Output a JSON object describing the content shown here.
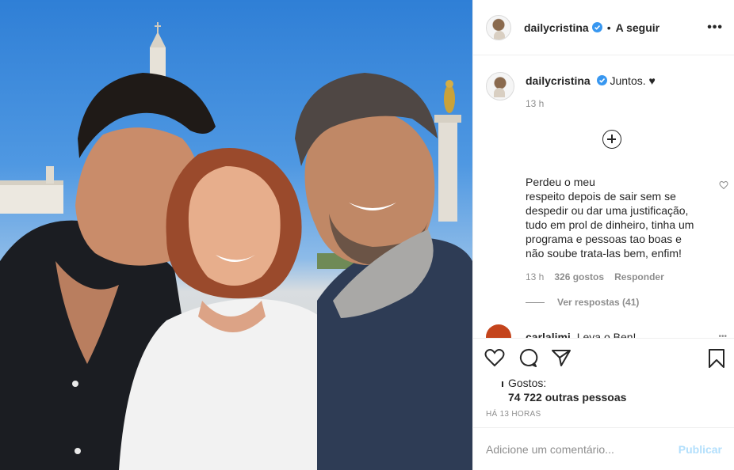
{
  "post": {
    "image_alt": "Selfie of three people in front of a sanctuary"
  },
  "header": {
    "username": "dailycristina",
    "separator": "•",
    "follow_label": "A seguir",
    "more_label": "•••"
  },
  "caption": {
    "username": "dailycristina",
    "text": "Juntos. ♥",
    "time": "13 h"
  },
  "comment": {
    "text": "Perdeu o meu\nrespeito depois de sair sem se\ndespedir ou dar uma justificação,\ntudo em prol de dinheiro, tinha um\nprograma e pessoas tao boas e\nnão soube trata-las bem, enfim!",
    "time": "13 h",
    "likes": "326 gostos",
    "reply_label": "Responder",
    "view_replies": "Ver respostas (41)"
  },
  "next_comment": {
    "username": "carlalimi",
    "text": "Leva o Ben!"
  },
  "actions": {
    "likes_label": "Gostos:",
    "likes_others": "74 722 outras pessoas",
    "date": "HÁ 13 HORAS"
  },
  "add_comment": {
    "placeholder": "Adicione um comentário...",
    "publish_label": "Publicar"
  },
  "colors": {
    "verified": "#3897f0",
    "publish": "#b2dffc",
    "muted": "#8e8e8e"
  }
}
